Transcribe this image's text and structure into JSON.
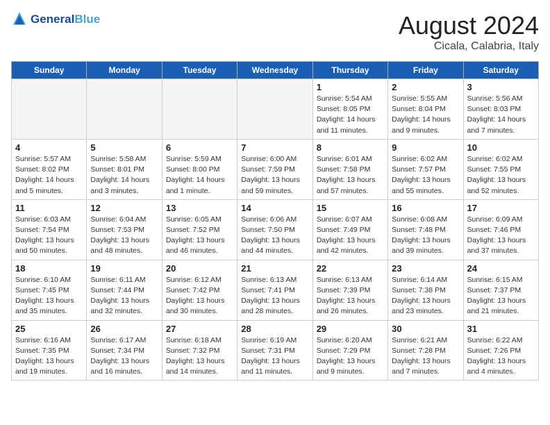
{
  "header": {
    "logo_line1": "General",
    "logo_line2": "Blue",
    "month_title": "August 2024",
    "location": "Cicala, Calabria, Italy"
  },
  "weekdays": [
    "Sunday",
    "Monday",
    "Tuesday",
    "Wednesday",
    "Thursday",
    "Friday",
    "Saturday"
  ],
  "weeks": [
    [
      {
        "day": "",
        "info": ""
      },
      {
        "day": "",
        "info": ""
      },
      {
        "day": "",
        "info": ""
      },
      {
        "day": "",
        "info": ""
      },
      {
        "day": "1",
        "info": "Sunrise: 5:54 AM\nSunset: 8:05 PM\nDaylight: 14 hours\nand 11 minutes."
      },
      {
        "day": "2",
        "info": "Sunrise: 5:55 AM\nSunset: 8:04 PM\nDaylight: 14 hours\nand 9 minutes."
      },
      {
        "day": "3",
        "info": "Sunrise: 5:56 AM\nSunset: 8:03 PM\nDaylight: 14 hours\nand 7 minutes."
      }
    ],
    [
      {
        "day": "4",
        "info": "Sunrise: 5:57 AM\nSunset: 8:02 PM\nDaylight: 14 hours\nand 5 minutes."
      },
      {
        "day": "5",
        "info": "Sunrise: 5:58 AM\nSunset: 8:01 PM\nDaylight: 14 hours\nand 3 minutes."
      },
      {
        "day": "6",
        "info": "Sunrise: 5:59 AM\nSunset: 8:00 PM\nDaylight: 14 hours\nand 1 minute."
      },
      {
        "day": "7",
        "info": "Sunrise: 6:00 AM\nSunset: 7:59 PM\nDaylight: 13 hours\nand 59 minutes."
      },
      {
        "day": "8",
        "info": "Sunrise: 6:01 AM\nSunset: 7:58 PM\nDaylight: 13 hours\nand 57 minutes."
      },
      {
        "day": "9",
        "info": "Sunrise: 6:02 AM\nSunset: 7:57 PM\nDaylight: 13 hours\nand 55 minutes."
      },
      {
        "day": "10",
        "info": "Sunrise: 6:02 AM\nSunset: 7:55 PM\nDaylight: 13 hours\nand 52 minutes."
      }
    ],
    [
      {
        "day": "11",
        "info": "Sunrise: 6:03 AM\nSunset: 7:54 PM\nDaylight: 13 hours\nand 50 minutes."
      },
      {
        "day": "12",
        "info": "Sunrise: 6:04 AM\nSunset: 7:53 PM\nDaylight: 13 hours\nand 48 minutes."
      },
      {
        "day": "13",
        "info": "Sunrise: 6:05 AM\nSunset: 7:52 PM\nDaylight: 13 hours\nand 46 minutes."
      },
      {
        "day": "14",
        "info": "Sunrise: 6:06 AM\nSunset: 7:50 PM\nDaylight: 13 hours\nand 44 minutes."
      },
      {
        "day": "15",
        "info": "Sunrise: 6:07 AM\nSunset: 7:49 PM\nDaylight: 13 hours\nand 42 minutes."
      },
      {
        "day": "16",
        "info": "Sunrise: 6:08 AM\nSunset: 7:48 PM\nDaylight: 13 hours\nand 39 minutes."
      },
      {
        "day": "17",
        "info": "Sunrise: 6:09 AM\nSunset: 7:46 PM\nDaylight: 13 hours\nand 37 minutes."
      }
    ],
    [
      {
        "day": "18",
        "info": "Sunrise: 6:10 AM\nSunset: 7:45 PM\nDaylight: 13 hours\nand 35 minutes."
      },
      {
        "day": "19",
        "info": "Sunrise: 6:11 AM\nSunset: 7:44 PM\nDaylight: 13 hours\nand 32 minutes."
      },
      {
        "day": "20",
        "info": "Sunrise: 6:12 AM\nSunset: 7:42 PM\nDaylight: 13 hours\nand 30 minutes."
      },
      {
        "day": "21",
        "info": "Sunrise: 6:13 AM\nSunset: 7:41 PM\nDaylight: 13 hours\nand 28 minutes."
      },
      {
        "day": "22",
        "info": "Sunrise: 6:13 AM\nSunset: 7:39 PM\nDaylight: 13 hours\nand 26 minutes."
      },
      {
        "day": "23",
        "info": "Sunrise: 6:14 AM\nSunset: 7:38 PM\nDaylight: 13 hours\nand 23 minutes."
      },
      {
        "day": "24",
        "info": "Sunrise: 6:15 AM\nSunset: 7:37 PM\nDaylight: 13 hours\nand 21 minutes."
      }
    ],
    [
      {
        "day": "25",
        "info": "Sunrise: 6:16 AM\nSunset: 7:35 PM\nDaylight: 13 hours\nand 19 minutes."
      },
      {
        "day": "26",
        "info": "Sunrise: 6:17 AM\nSunset: 7:34 PM\nDaylight: 13 hours\nand 16 minutes."
      },
      {
        "day": "27",
        "info": "Sunrise: 6:18 AM\nSunset: 7:32 PM\nDaylight: 13 hours\nand 14 minutes."
      },
      {
        "day": "28",
        "info": "Sunrise: 6:19 AM\nSunset: 7:31 PM\nDaylight: 13 hours\nand 11 minutes."
      },
      {
        "day": "29",
        "info": "Sunrise: 6:20 AM\nSunset: 7:29 PM\nDaylight: 13 hours\nand 9 minutes."
      },
      {
        "day": "30",
        "info": "Sunrise: 6:21 AM\nSunset: 7:28 PM\nDaylight: 13 hours\nand 7 minutes."
      },
      {
        "day": "31",
        "info": "Sunrise: 6:22 AM\nSunset: 7:26 PM\nDaylight: 13 hours\nand 4 minutes."
      }
    ]
  ]
}
